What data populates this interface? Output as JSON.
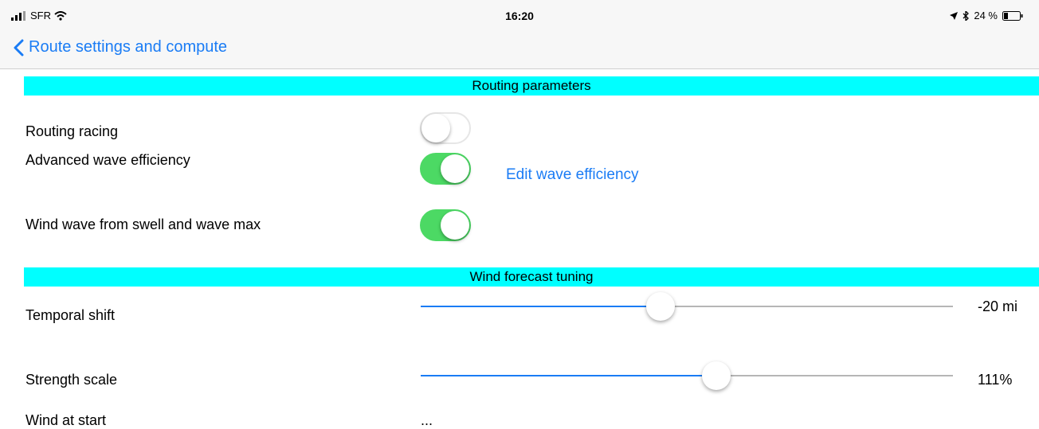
{
  "status_bar": {
    "carrier": "SFR",
    "time": "16:20",
    "battery": "24 %"
  },
  "nav": {
    "back_label": "Route settings and compute"
  },
  "sections": {
    "routing_parameters": "Routing parameters",
    "wind_forecast_tuning": "Wind forecast tuning"
  },
  "routing": {
    "racing_label": "Routing racing",
    "racing_on": false,
    "advanced_wave_label": "Advanced wave efficiency",
    "advanced_wave_on": true,
    "edit_wave_link": "Edit wave efficiency",
    "wind_wave_label": "Wind wave from swell and wave max",
    "wind_wave_on": true
  },
  "wind": {
    "temporal_shift_label": "Temporal shift",
    "temporal_shift_value": "-20 mi",
    "temporal_shift_fraction": 0.45,
    "strength_scale_label": "Strength scale",
    "strength_scale_value": "111%",
    "strength_scale_fraction": 0.555,
    "wind_at_start_label": "Wind at start",
    "wind_at_start_value": "..."
  },
  "colors": {
    "accent": "#1a7cf5",
    "section_bg": "#00ffff",
    "toggle_on": "#4cd964"
  }
}
